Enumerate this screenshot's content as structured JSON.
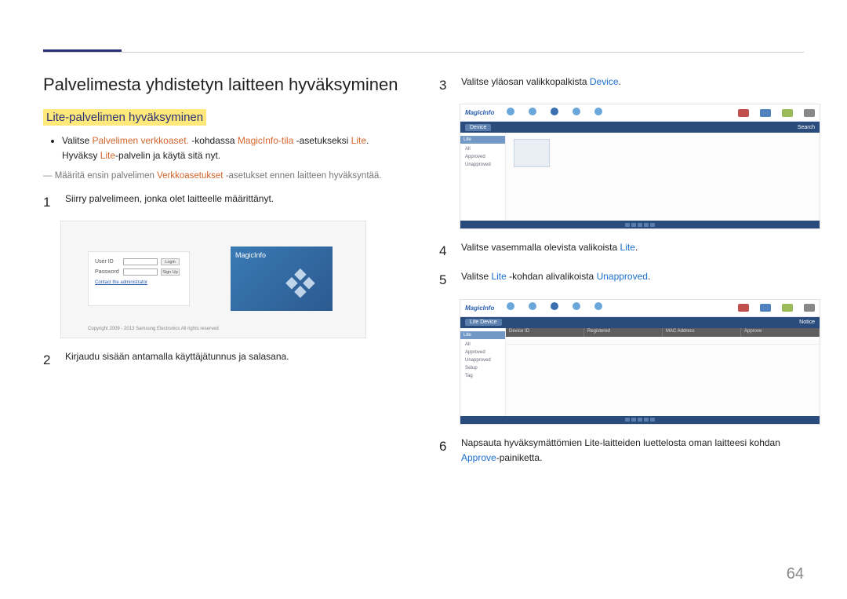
{
  "page_number": "64",
  "heading": "Palvelimesta yhdistetyn laitteen hyväksyminen",
  "subheading": "Lite-palvelimen hyväksyminen",
  "bullet": {
    "pre": "Valitse ",
    "orange1": "Palvelimen verkkoaset.",
    "mid1": " -kohdassa ",
    "orange2": "MagicInfo-tila",
    "mid2": " -asetukseksi ",
    "orange3": "Lite",
    "post": ".",
    "line2a": "Hyväksy ",
    "line2_orange": "Lite",
    "line2b": "-palvelin ja käytä sitä nyt."
  },
  "note": {
    "pre": "Määritä ensin palvelimen ",
    "orange": "Verkkoasetukset",
    "post": " -asetukset ennen laitteen hyväksyntää."
  },
  "steps_left": {
    "s1": {
      "num": "1",
      "text": "Siirry palvelimeen, jonka olet laitteelle määrittänyt."
    },
    "s2": {
      "num": "2",
      "text": "Kirjaudu sisään antamalla käyttäjätunnus ja salasana."
    }
  },
  "steps_right": {
    "s3": {
      "num": "3",
      "pre": "Valitse yläosan valikkopalkista ",
      "blue": "Device",
      "post": "."
    },
    "s4": {
      "num": "4",
      "pre": "Valitse vasemmalla olevista valikoista ",
      "blue": "Lite",
      "post": "."
    },
    "s5": {
      "num": "5",
      "pre": "Valitse ",
      "blue1": "Lite",
      "mid": " -kohdan alivalikoista ",
      "blue2": "Unapproved",
      "post": "."
    },
    "s6": {
      "num": "6",
      "pre": "Napsauta hyväksymättömien Lite-laitteiden luettelosta oman laitteesi kohdan ",
      "blue": "Approve",
      "post": "-painiketta."
    }
  },
  "login_shot": {
    "user_label": "User ID",
    "pass_label": "Password",
    "login_btn": "Login",
    "signup_btn": "Sign Up",
    "admin_link": "Contact the administrator",
    "copyright": "Copyright 2009 - 2013 Samsung Electronics All rights reserved",
    "brand": "MagicInfo"
  },
  "app_shot": {
    "brand": "MagicInfo",
    "crumb": "Device",
    "search_btn": "Search",
    "side_header": "Lite",
    "side_items": [
      "All",
      "Approved",
      "Unapproved",
      "Setup",
      "Tag"
    ],
    "tab_title": "Lite Device",
    "notice": "Notice",
    "cols": [
      "Device ID",
      "",
      "Registered",
      "",
      "MAC Address",
      "",
      "Approve"
    ]
  }
}
